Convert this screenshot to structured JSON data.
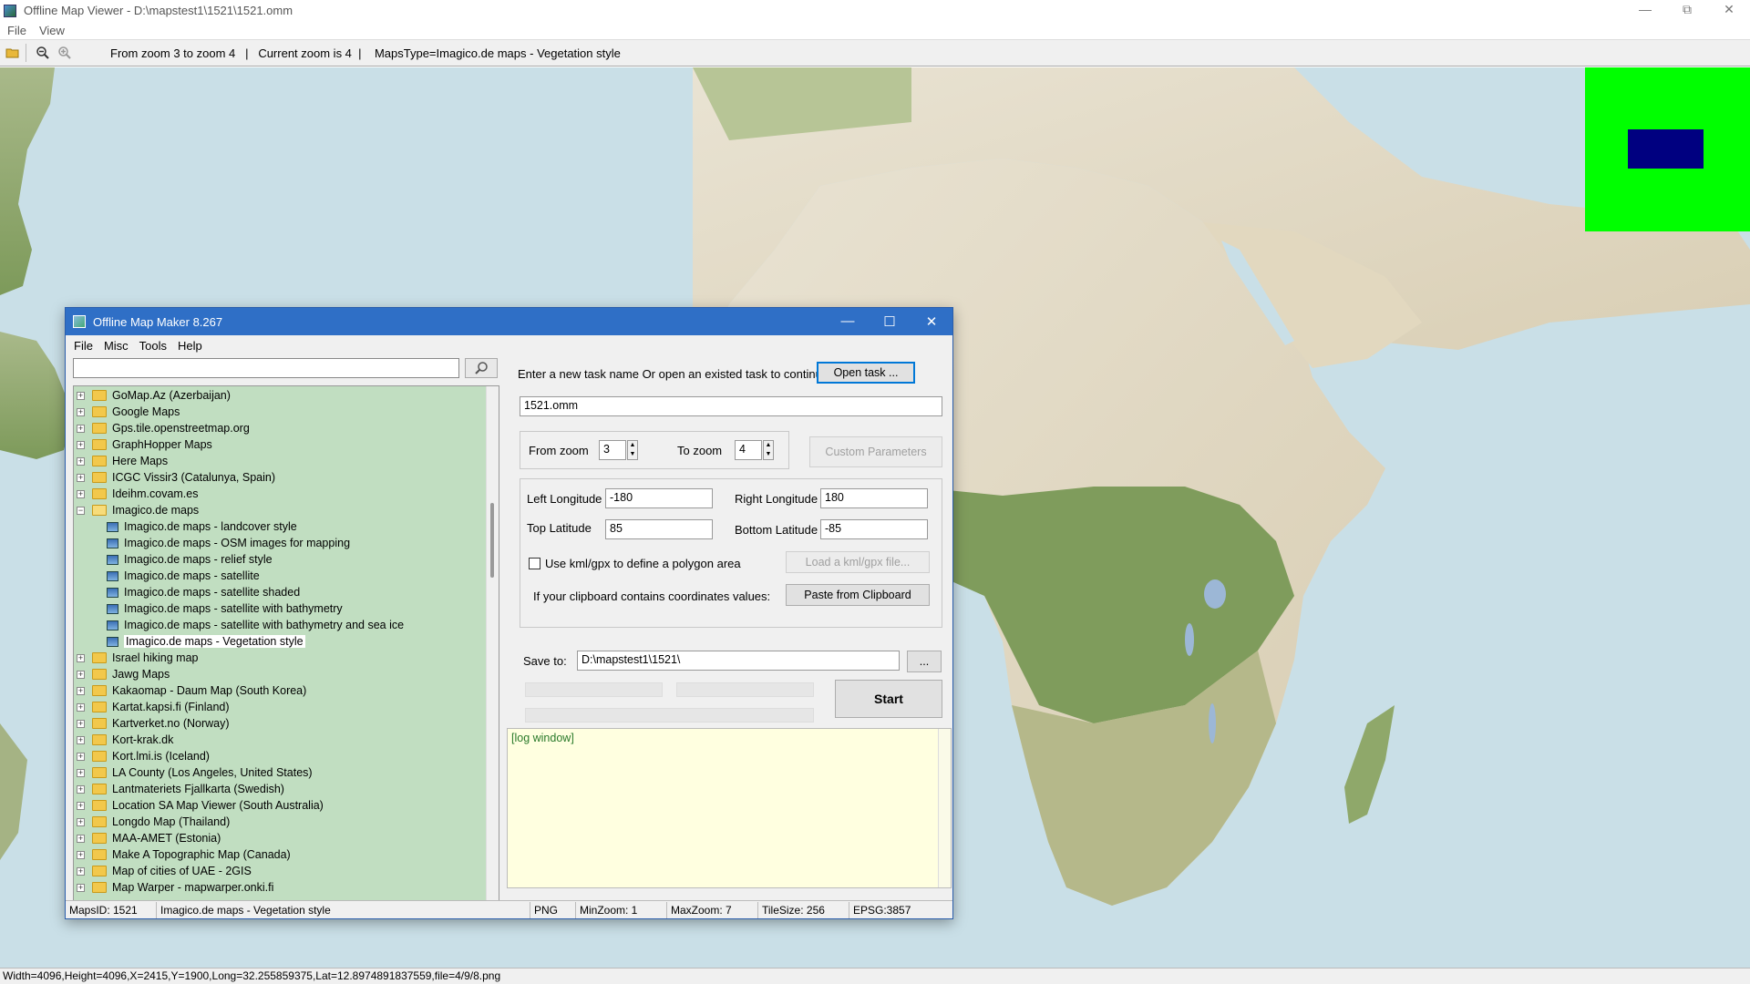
{
  "viewer": {
    "title": "Offline Map Viewer - D:\\mapstest1\\1521\\1521.omm",
    "menu": [
      "File",
      "View"
    ],
    "toolbar_info": "From zoom 3 to zoom 4   |   Current zoom is 4  |    MapsType=Imagico.de maps - Vegetation style",
    "status": "Width=4096,Height=4096,X=2415,Y=1900,Long=32.255859375,Lat=12.8974891837559,file=4/9/8.png",
    "icons": [
      "folder-open-icon",
      "zoom-out-icon",
      "zoom-in-icon"
    ]
  },
  "colors": {
    "overview_bg": "#00ff00",
    "overview_frame": "#000080",
    "dialog_title": "#2f6fc6",
    "tree_bg": "#c1dec1",
    "log_bg": "#ffffe0"
  },
  "dialog": {
    "title": "Offline Map Maker 8.267",
    "menu": [
      "File",
      "Misc",
      "Tools",
      "Help"
    ],
    "search": {
      "value": "",
      "placeholder": ""
    },
    "tree": {
      "groups_before": [
        "GoMap.Az (Azerbaijan)",
        "Google Maps",
        "Gps.tile.openstreetmap.org",
        "GraphHopper Maps",
        "Here Maps",
        "ICGC Vissir3 (Catalunya, Spain)",
        "Ideihm.covam.es"
      ],
      "expanded": {
        "label": "Imagico.de maps",
        "children": [
          "Imagico.de maps - landcover style",
          "Imagico.de maps - OSM images for mapping",
          "Imagico.de maps - relief style",
          "Imagico.de maps - satellite",
          "Imagico.de maps - satellite shaded",
          "Imagico.de maps - satellite with bathymetry",
          "Imagico.de maps - satellite with bathymetry and sea ice",
          "Imagico.de maps - Vegetation style"
        ],
        "selected": "Imagico.de maps - Vegetation style"
      },
      "groups_after": [
        "Israel hiking map",
        "Jawg Maps",
        "Kakaomap - Daum Map (South Korea)",
        "Kartat.kapsi.fi (Finland)",
        "Kartverket.no (Norway)",
        "Kort-krak.dk",
        "Kort.lmi.is (Iceland)",
        "LA County (Los Angeles, United States)",
        "Lantmateriets Fjallkarta (Swedish)",
        "Location SA Map Viewer (South Australia)",
        "Longdo Map (Thailand)",
        "MAA-AMET (Estonia)",
        "Make A Topographic Map (Canada)",
        "Map of cities of UAE - 2GIS",
        "Map Warper - mapwarper.onki.fi"
      ]
    },
    "task": {
      "prompt": "Enter a new task name Or open an existed task to continue:",
      "open_button": "Open task ...",
      "name": "1521.omm"
    },
    "zoom": {
      "from_label": "From zoom",
      "from_value": "3",
      "to_label": "To zoom",
      "to_value": "4",
      "custom_button": "Custom Parameters"
    },
    "bounds": {
      "left_label": "Left Longitude",
      "left_value": "-180",
      "right_label": "Right Longitude",
      "right_value": "180",
      "top_label": "Top Latitude",
      "top_value": "85",
      "bottom_label": "Bottom Latitude",
      "bottom_value": "-85",
      "kml_label": "Use kml/gpx to define a polygon area",
      "kml_checked": false,
      "kml_button": "Load a kml/gpx file...",
      "clip_label": "If your clipboard contains coordinates values:",
      "clip_button": "Paste from Clipboard"
    },
    "save": {
      "label": "Save to:",
      "value": "D:\\mapstest1\\1521\\",
      "browse": "..."
    },
    "start_button": "Start",
    "log": "[log window]",
    "status": {
      "maps_id": "MapsID: 1521",
      "maps_name": "Imagico.de maps - Vegetation style",
      "format": "PNG",
      "min_zoom": "MinZoom: 1",
      "max_zoom": "MaxZoom: 7",
      "tile_size": "TileSize: 256",
      "epsg": "EPSG:3857"
    }
  }
}
